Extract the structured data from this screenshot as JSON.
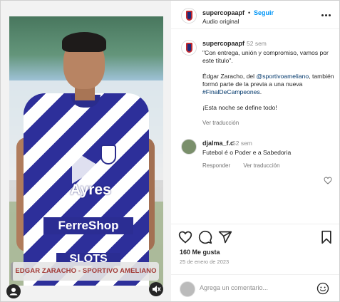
{
  "post": {
    "account": "supercopaapf",
    "separator": "•",
    "follow_label": "Seguir",
    "audio_label": "Audio original",
    "caption": {
      "username": "supercopaapf",
      "time": "52 sem",
      "line1": "\"Con entrega, unión y compromiso, vamos por este título\".",
      "line2_before": "Édgar Zaracho, del ",
      "line2_mention": "@sportivoameliano",
      "line2_mid": ", también formó parte de la previa a una nueva ",
      "line2_hashtag": "#FinalDeCampeones",
      "line2_end": ".",
      "line3": "¡Esta noche se define todo!",
      "translate_label": "Ver traducción"
    },
    "comment": {
      "username": "djalma_f.c",
      "time": "52 sem",
      "text": "Futebol é o Poder e a Sabedoria",
      "reply_label": "Responder",
      "translate_label": "Ver traducción"
    },
    "likes": "160 Me gusta",
    "date": "25 de enero de 2023",
    "add_comment_placeholder": "Agrega un comentario..."
  },
  "media": {
    "caption_bar": "EDGAR ZARACHO - SPORTIVO AMELIANO",
    "sponsor_ayres": "Ayres",
    "sponsor_ferreshop": "FerreShop",
    "sponsor_slots": "SLOTS"
  },
  "icons": {
    "more": "more-options-icon",
    "like": "heart-icon",
    "comment": "comment-icon",
    "share": "share-icon",
    "save": "bookmark-icon",
    "emoji": "emoji-icon",
    "play": "play-icon",
    "mute": "muted-speaker-icon",
    "tag": "user-tag-icon"
  },
  "colors": {
    "follow": "#0095f6",
    "link": "#00376b",
    "caption_bar_text": "#a23a36"
  }
}
